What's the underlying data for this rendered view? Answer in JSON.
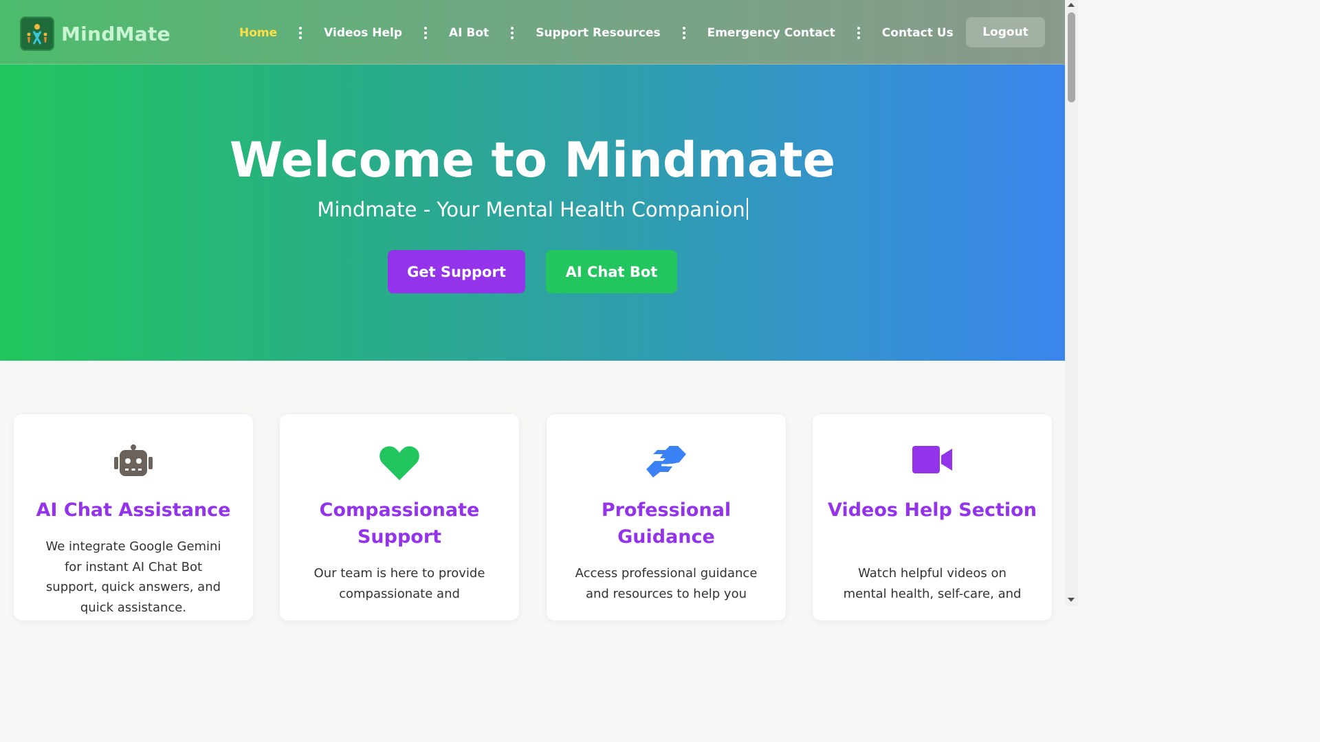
{
  "brand": {
    "name": "MindMate",
    "logo_icon": "ribbon-people-logo-icon"
  },
  "nav": {
    "items": [
      {
        "label": "Home",
        "active": true
      },
      {
        "label": "Videos Help",
        "active": false
      },
      {
        "label": "AI Bot",
        "active": false
      },
      {
        "label": "Support Resources",
        "active": false
      },
      {
        "label": "Emergency Contact",
        "active": false
      },
      {
        "label": "Contact Us",
        "active": false
      }
    ],
    "logout_label": "Logout",
    "active_color": "#fde047"
  },
  "hero": {
    "title": "Welcome to Mindmate",
    "subtitle": "Mindmate - Your Mental Health Companion",
    "buttons": {
      "support": "Get Support",
      "chat": "AI Chat Bot"
    },
    "colors": {
      "support": "#9333ea",
      "chat": "#22c55e",
      "gradient_start": "#22c55e",
      "gradient_end": "#3b82f6"
    }
  },
  "features": [
    {
      "icon": "robot-icon",
      "icon_color": "#6b625c",
      "title": "AI Chat Assistance",
      "text": "We integrate Google Gemini for instant AI Chat Bot support, quick answers, and quick assistance."
    },
    {
      "icon": "heart-icon",
      "icon_color": "#22c55e",
      "title": "Compassionate Support",
      "text": "Our team is here to provide compassionate and"
    },
    {
      "icon": "handshake-icon",
      "icon_color": "#3b82f6",
      "title": "Professional Guidance",
      "text": "Access professional guidance and resources to help you"
    },
    {
      "icon": "video-camera-icon",
      "icon_color": "#9333ea",
      "title": "Videos Help Section",
      "text": "Watch helpful videos on mental health, self-care, and"
    }
  ]
}
